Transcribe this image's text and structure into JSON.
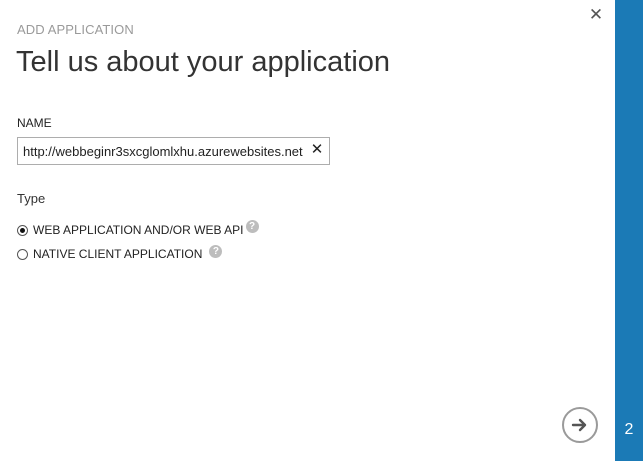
{
  "dialog": {
    "overline": "ADD APPLICATION",
    "title": "Tell us about your application",
    "close_icon": "close-icon",
    "close_glyph": "✕"
  },
  "name_field": {
    "label": "NAME",
    "value": "http://webbeginr3sxcglomlxhu.azurewebsites.net",
    "clear_icon": "clear-icon",
    "clear_glyph": "✕"
  },
  "type_group": {
    "label": "Type",
    "options": [
      {
        "label": "WEB APPLICATION AND/OR WEB API",
        "selected": true,
        "help": "?"
      },
      {
        "label": "NATIVE CLIENT APPLICATION",
        "selected": false,
        "help": "?"
      }
    ]
  },
  "wizard": {
    "step": "2",
    "next_icon": "arrow-right-circle-icon",
    "accent_color": "#1b7ab6"
  }
}
